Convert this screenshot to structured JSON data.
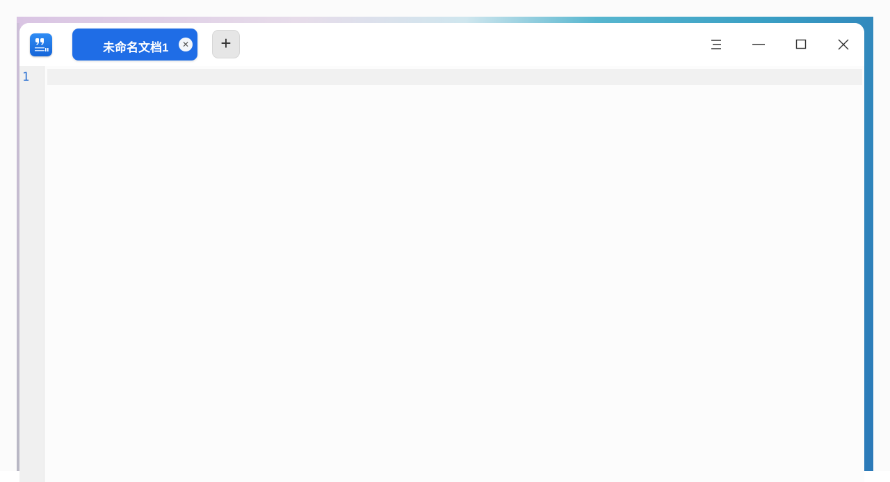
{
  "window": {
    "app_icon": "text-editor-icon",
    "tabs": [
      {
        "label": "未命名文档1",
        "active": true,
        "close_icon": "close-icon"
      }
    ],
    "add_tab_icon": "plus-icon",
    "controls": {
      "menu_icon": "menu-icon",
      "minimize_icon": "minimize-icon",
      "maximize_icon": "maximize-icon",
      "close_icon": "close-icon"
    }
  },
  "editor": {
    "line_numbers": [
      "1"
    ],
    "content": ""
  },
  "colors": {
    "accent": "#1f6de6",
    "line_number": "#2a6fd1",
    "gutter_bg": "#f0f0f0",
    "current_line_bg": "#f1f1f1"
  }
}
